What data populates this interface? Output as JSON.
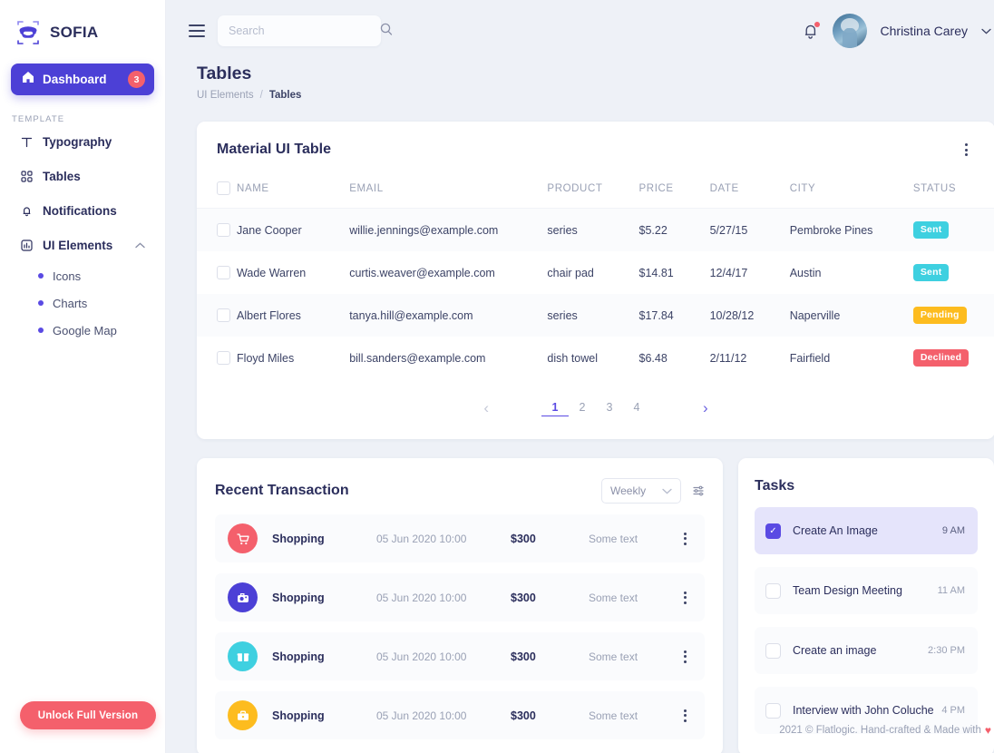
{
  "sidebar": {
    "logo_text": "SOFIA",
    "active_item": {
      "label": "Dashboard",
      "badge": "3",
      "icon": "home-icon"
    },
    "section_label": "TEMPLATE",
    "items": [
      {
        "label": "Typography",
        "icon": "typography-icon"
      },
      {
        "label": "Tables",
        "icon": "tables-icon"
      },
      {
        "label": "Notifications",
        "icon": "bell-icon"
      },
      {
        "label": "UI Elements",
        "icon": "chart-square-icon",
        "expanded": true
      }
    ],
    "subitems": [
      {
        "label": "Icons"
      },
      {
        "label": "Charts"
      },
      {
        "label": "Google Map"
      }
    ],
    "unlock_button": "Unlock Full Version"
  },
  "topbar": {
    "search_placeholder": "Search",
    "search_value": "",
    "username": "Christina Carey"
  },
  "page": {
    "title": "Tables",
    "breadcrumb_parent": "UI Elements",
    "breadcrumb_sep": "/",
    "breadcrumb_current": "Tables"
  },
  "table": {
    "title": "Material UI Table",
    "columns": [
      "NAME",
      "EMAIL",
      "PRODUCT",
      "PRICE",
      "DATE",
      "CITY",
      "STATUS"
    ],
    "rows": [
      {
        "name": "Jane Cooper",
        "email": "willie.jennings@example.com",
        "product": "series",
        "price": "$5.22",
        "date": "5/27/15",
        "city": "Pembroke Pines",
        "status": "Sent",
        "status_type": "sent"
      },
      {
        "name": "Wade Warren",
        "email": "curtis.weaver@example.com",
        "product": "chair pad",
        "price": "$14.81",
        "date": "12/4/17",
        "city": "Austin",
        "status": "Sent",
        "status_type": "sent"
      },
      {
        "name": "Albert Flores",
        "email": "tanya.hill@example.com",
        "product": "series",
        "price": "$17.84",
        "date": "10/28/12",
        "city": "Naperville",
        "status": "Pending",
        "status_type": "pending"
      },
      {
        "name": "Floyd Miles",
        "email": "bill.sanders@example.com",
        "product": "dish towel",
        "price": "$6.48",
        "date": "2/11/12",
        "city": "Fairfield",
        "status": "Declined",
        "status_type": "declined"
      }
    ],
    "pagination": {
      "pages": [
        "1",
        "2",
        "3",
        "4"
      ],
      "active": "1",
      "prev": "‹",
      "next": "›"
    }
  },
  "transactions": {
    "title": "Recent Transaction",
    "period_selected": "Weekly",
    "rows": [
      {
        "label": "Shopping",
        "date": "05 Jun 2020 10:00",
        "amount": "$300",
        "note": "Some text",
        "icon": "cart-icon",
        "color": "#f4606c"
      },
      {
        "label": "Shopping",
        "date": "05 Jun 2020 10:00",
        "amount": "$300",
        "note": "Some text",
        "icon": "camera-icon",
        "color": "#4c40d6"
      },
      {
        "label": "Shopping",
        "date": "05 Jun 2020 10:00",
        "amount": "$300",
        "note": "Some text",
        "icon": "gift-icon",
        "color": "#3ed0e0"
      },
      {
        "label": "Shopping",
        "date": "05 Jun 2020 10:00",
        "amount": "$300",
        "note": "Some text",
        "icon": "briefcase-icon",
        "color": "#fdbc1f"
      }
    ]
  },
  "tasks": {
    "title": "Tasks",
    "items": [
      {
        "label": "Create An Image",
        "time": "9 AM",
        "checked": true
      },
      {
        "label": "Team Design Meeting",
        "time": "11 AM",
        "checked": false
      },
      {
        "label": "Create an image",
        "time": "2:30 PM",
        "checked": false
      },
      {
        "label": "Interview with John Coluche",
        "time": "4 PM",
        "checked": false
      }
    ]
  },
  "footer": {
    "text": "2021 © Flatlogic. Hand-crafted & Made with",
    "heart": "♥"
  },
  "colors": {
    "accent": "#5a4ae3",
    "accent_dark": "#4c40d6",
    "danger": "#f4606c",
    "warning": "#fdbc1f",
    "info": "#3ed0e0",
    "text": "#2b2e5c",
    "muted": "#9aa1b5",
    "background": "#eef1f7"
  }
}
